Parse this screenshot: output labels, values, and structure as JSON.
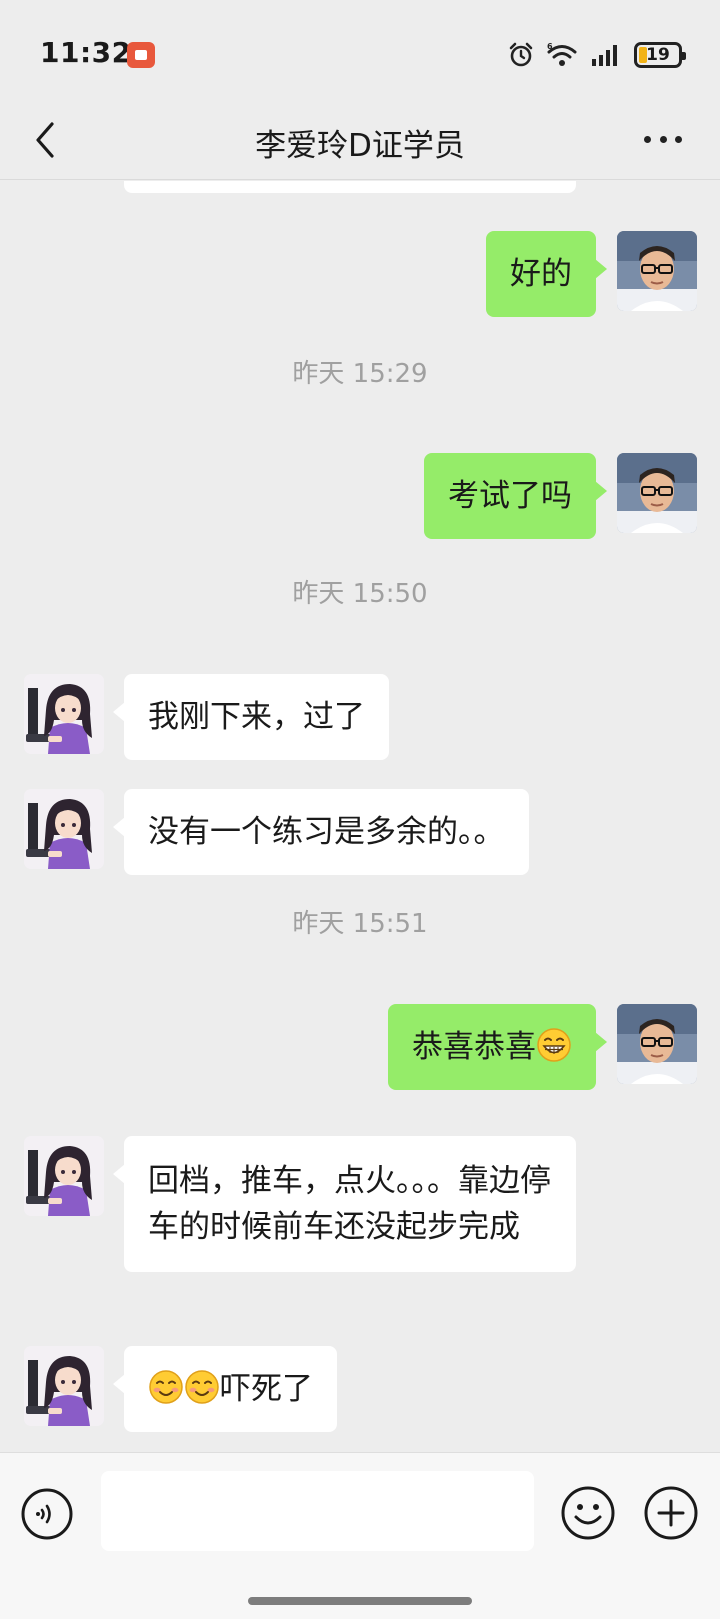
{
  "status_bar": {
    "time": "11:32",
    "battery": "19",
    "icons": [
      "screen-record-icon",
      "alarm-icon",
      "wifi-6-icon",
      "signal-icon",
      "battery-icon"
    ]
  },
  "header": {
    "title": "李爱玲D证学员",
    "icons": [
      "back-arrow-icon",
      "more-dots-icon"
    ]
  },
  "messages": {
    "m1": "好的",
    "t1": "昨天 15:29",
    "m2": "考试了吗",
    "t2": "昨天 15:50",
    "m3": "我刚下来，过了",
    "m4": "没有一个练习是多余的。。",
    "t3": "昨天 15:51",
    "m5": "恭喜恭喜",
    "m5_emoji": "grinning-face-emoji",
    "m6": "回档，推车，点火。。。靠边停车的时候前车还没起步完成",
    "m7": "吓死了",
    "m7_emojis": [
      "smiling-face-emoji",
      "smiling-face-emoji"
    ]
  },
  "input_bar": {
    "placeholder": "",
    "icons": [
      "voice-icon",
      "emoji-icon",
      "plus-icon"
    ]
  },
  "colors": {
    "background": "#ededed",
    "outgoing_bubble": "#95ec69",
    "incoming_bubble": "#ffffff",
    "timestamp_text": "#a0a0a0",
    "record_badge": "#e8583c"
  }
}
